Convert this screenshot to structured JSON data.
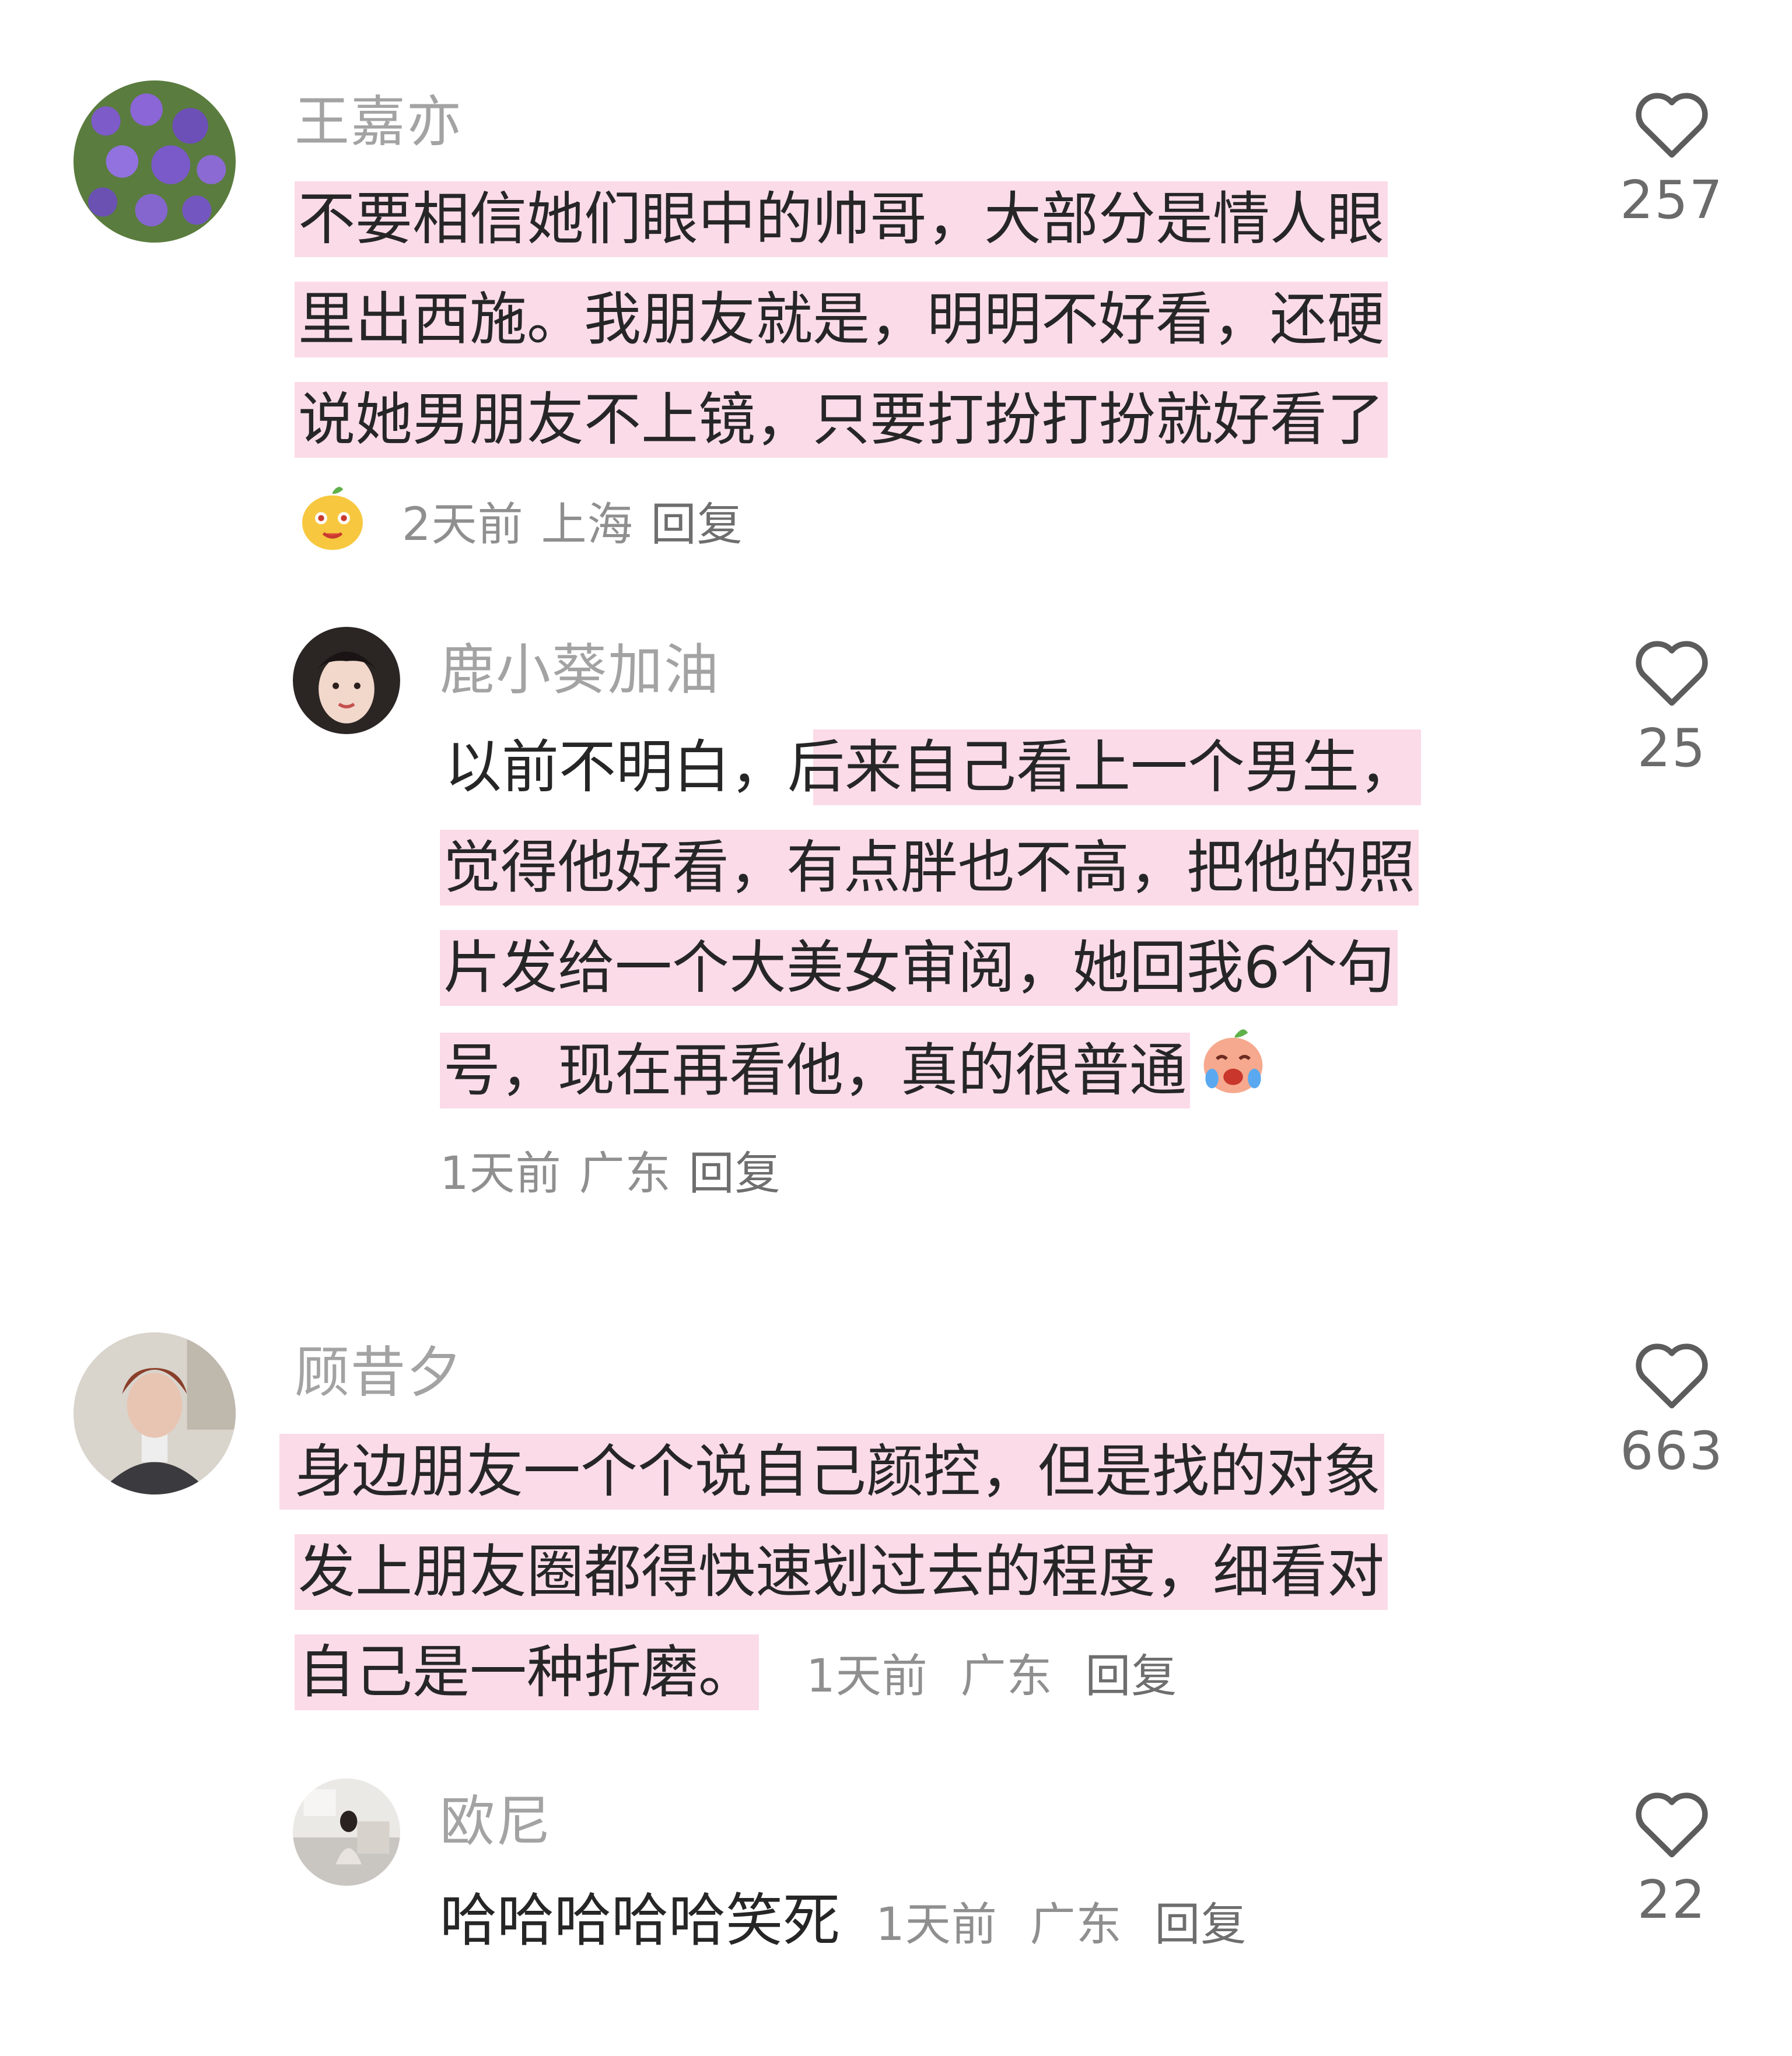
{
  "comments": [
    {
      "username": "王嘉亦",
      "lines": [
        "不要相信她们眼中的帅哥，大部分是情人眼",
        "里出西施。我朋友就是，明明不好看，还硬",
        "说她男朋友不上镜，只要打扮打扮就好看了"
      ],
      "time": "2天前",
      "location": "上海",
      "reply": "回复",
      "likes": "257",
      "sticker_icon": "happy-sticker-icon"
    },
    {
      "username": "鹿小葵加油",
      "lines": [
        "以前不明白，后来自己看上一个男生，",
        "觉得他好看，有点胖也不高，把他的照",
        "片发给一个大美女审阅，她回我6个句",
        "号，现在再看他，真的很普通"
      ],
      "time": "1天前",
      "location": "广东",
      "reply": "回复",
      "likes": "25",
      "emoji_icon": "crying-laughing-emoji-icon"
    },
    {
      "username": "顾昔夕",
      "lines": [
        "身边朋友一个个说自己颜控，但是找的对象",
        "发上朋友圈都得快速划过去的程度，细看对",
        "自己是一种折磨。"
      ],
      "time": "1天前",
      "location": "广东",
      "reply": "回复",
      "likes": "663"
    },
    {
      "username": "欧尼",
      "lines": [
        "哈哈哈哈哈笑死"
      ],
      "time": "1天前",
      "location": "广东",
      "reply": "回复",
      "likes": "22"
    }
  ],
  "colors": {
    "highlight": "#fbdbe8",
    "username": "#a3a3a3",
    "text": "#262626",
    "meta": "#8f8f8f"
  }
}
